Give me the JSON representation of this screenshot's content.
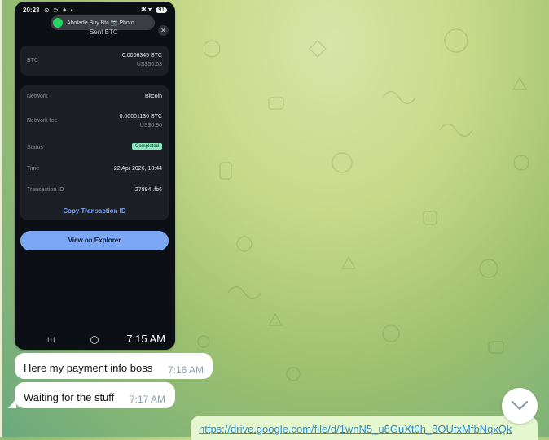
{
  "phone": {
    "status_time": "20:23",
    "status_left_icons": "⊙ ⊃ ✦ •",
    "status_right": "✱ ▾",
    "battery": "91",
    "notification": "Abolade Buy Btc  📷 Photo",
    "sheet_title": "Sent BTC",
    "close": "✕",
    "btc_label": "BTC",
    "btc_amount": "0.0006345 BTC",
    "btc_usd": "US$50.03",
    "rows": {
      "network_label": "Network",
      "network_value": "Bitcoin",
      "fee_label": "Network fee",
      "fee_value": "0.00001136 BTC",
      "fee_usd": "US$0.90",
      "status_label": "Status",
      "status_value": "Completed",
      "time_label": "Time",
      "time_value": "22 Apr 2026, 18:44",
      "txid_label": "Transaction ID",
      "txid_value": "27894..fb6"
    },
    "copy_link": "Copy Transaction ID",
    "explorer_button": "View on Explorer",
    "nav_recent": "III",
    "image_time": "7:15 AM"
  },
  "messages": [
    {
      "text": "Here my payment info boss",
      "time": "7:16 AM"
    },
    {
      "text": "Waiting for the stuff",
      "time": "7:17 AM"
    }
  ],
  "outgoing_link": "https://drive.google.com/file/d/1wnN5_u8GuXt0h_8OUfxMfbNqxQk",
  "colors": {
    "accent_blue": "#7ba7f5",
    "completed_badge": "#8be8c0",
    "link": "#2a8fd6"
  },
  "icons": {
    "scroll_down": "chevron-down-icon",
    "close": "close-icon",
    "whatsapp": "whatsapp-icon"
  }
}
